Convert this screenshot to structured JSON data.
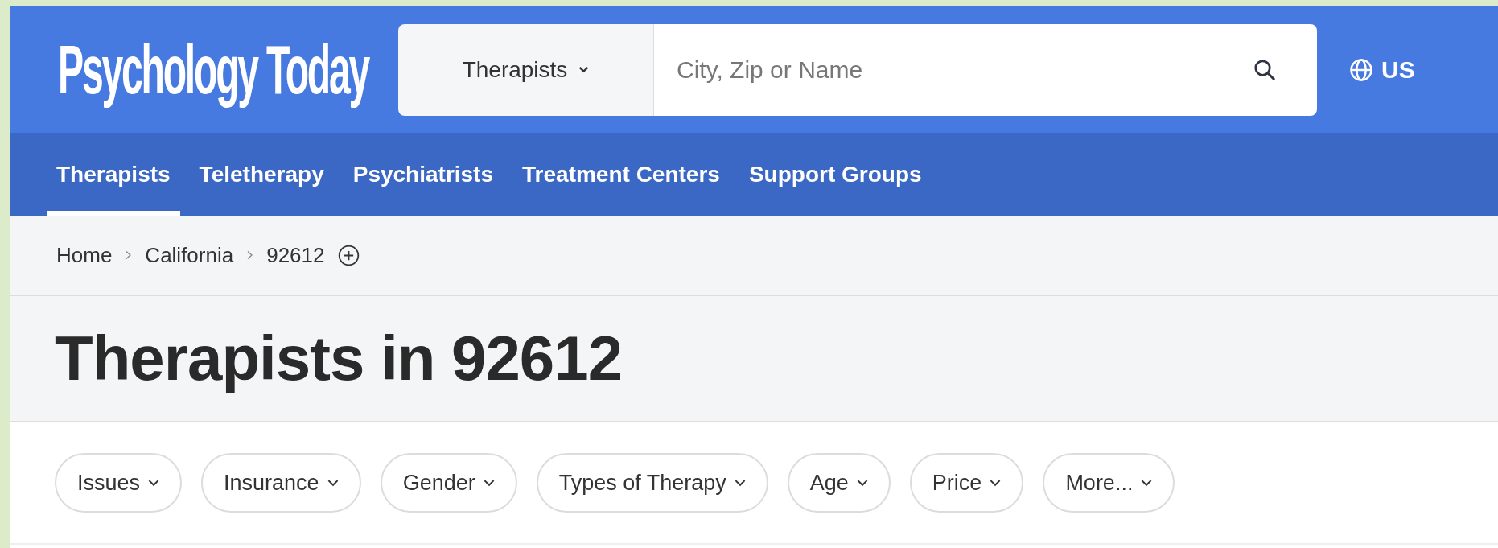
{
  "header": {
    "logo": "Psychology Today",
    "search": {
      "category": "Therapists",
      "placeholder": "City, Zip or Name"
    },
    "region": "US"
  },
  "nav": [
    {
      "label": "Therapists",
      "selected": true
    },
    {
      "label": "Teletherapy",
      "selected": false
    },
    {
      "label": "Psychiatrists",
      "selected": false
    },
    {
      "label": "Treatment Centers",
      "selected": false
    },
    {
      "label": "Support Groups",
      "selected": false
    }
  ],
  "breadcrumb": [
    "Home",
    "California",
    "92612"
  ],
  "title": "Therapists in 92612",
  "filters": [
    "Issues",
    "Insurance",
    "Gender",
    "Types of Therapy",
    "Age",
    "Price",
    "More..."
  ]
}
